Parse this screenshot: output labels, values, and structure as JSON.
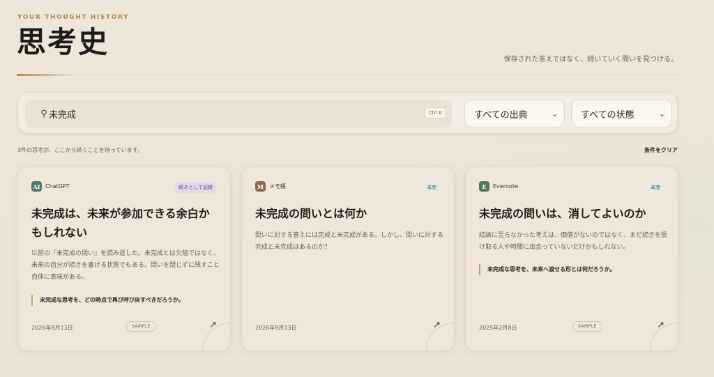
{
  "header": {
    "eyebrow": "YOUR THOUGHT HISTORY",
    "title": "思考史",
    "tagline": "保存された答えではなく、続いていく問いを見つける。"
  },
  "filters": {
    "search_value": "未完成",
    "shortcut": "Ctrl K",
    "source_select": "すべての出典",
    "status_select": "すべての状態"
  },
  "results": {
    "summary": "3件の思考が、ここから続くことを待っています。",
    "clear_label": "条件をクリア"
  },
  "cards": [
    {
      "source_initial": "AI",
      "source_name": "ChatGPT",
      "source_color": "#4e7a6a",
      "status": "続きとして記録",
      "status_bg": "#e4d8ec",
      "status_color": "#5a3d6b",
      "title": "未完成は、未来が参加できる余白かもしれない",
      "body": "以前の『未完成の問い』を読み返した。未完成とは欠陥ではなく、未来の自分が続きを書ける状態でもある。問いを閉じずに残すこと自体に意味がある。",
      "quote": "未完成な思考を、どの時点で再び呼び戻すべきだろうか。",
      "date": "2026年9月13日",
      "sample": "SAMPLE"
    },
    {
      "source_initial": "M",
      "source_name": "メモ帳",
      "source_color": "#8a6a4f",
      "status": "未完",
      "status_bg": "#e6ece6",
      "status_color": "#3a4a40",
      "title": "未完成の問いとは何か",
      "body": "問いに対する答えには完成と未完成がある。しかし、問いに対する完成と未完成はあるのか？",
      "quote": "",
      "date": "2026年9月13日",
      "sample": ""
    },
    {
      "source_initial": "E",
      "source_name": "Evernote",
      "source_color": "#4f7a5a",
      "status": "未完",
      "status_bg": "#e6ece6",
      "status_color": "#3a4a40",
      "title": "未完成の問いは、消してよいのか",
      "body": "結論に至らなかった考えは、価値がないのではなく、まだ続きを受け取る人や時間に出会っていないだけかもしれない。",
      "quote": "未完成な思考を、未来へ渡せる形とは何だろうか。",
      "date": "2025年2月8日",
      "sample": "SAMPLE"
    }
  ]
}
